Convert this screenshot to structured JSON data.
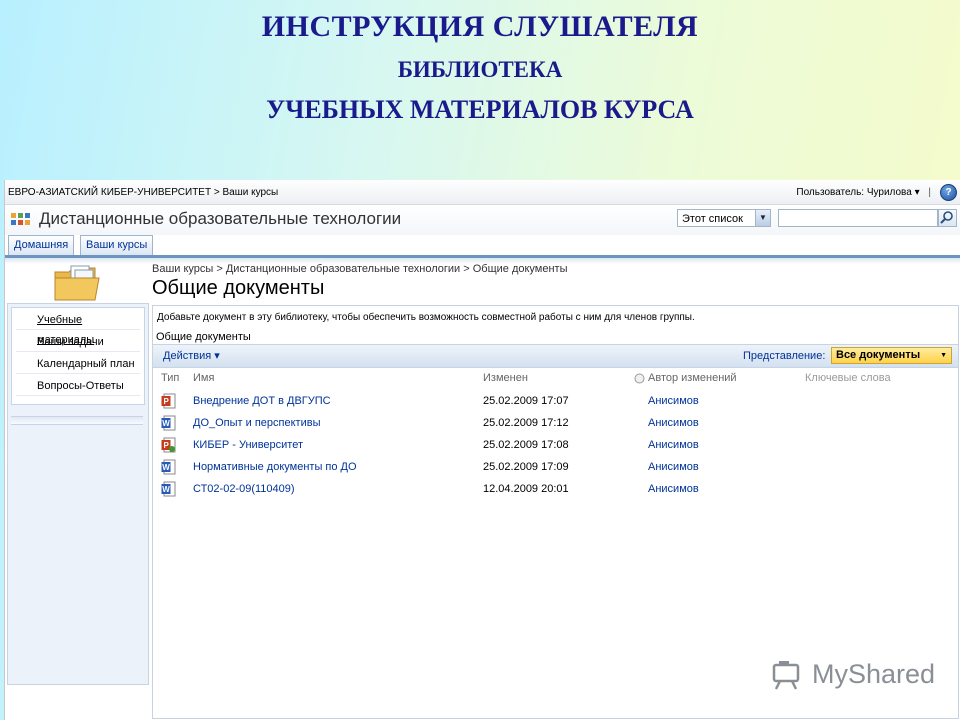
{
  "slide": {
    "title_line1": "ИНСТРУКЦИЯ СЛУШАТЕЛЯ",
    "title_line2": "БИБЛИОТЕКА",
    "title_line3": "УЧЕБНЫХ  МАТЕРИАЛОВ  КУРСА"
  },
  "topbar": {
    "breadcrumb": "ЕВРО-АЗИАТСКИЙ КИБЕР-УНИВЕРСИТЕТ > Ваши курсы",
    "user_label": "Пользователь: Чурилова ▾",
    "separator": "|",
    "help_icon": "?"
  },
  "header": {
    "site_title": "Дистанционные образовательные технологии",
    "search_scope": "Этот список",
    "search_placeholder": ""
  },
  "tabs": [
    {
      "label": "Домашняя"
    },
    {
      "label": "Ваши курсы"
    }
  ],
  "leftnav": {
    "items": [
      {
        "label": "Учебные материалы"
      },
      {
        "label": "Ваши задачи"
      },
      {
        "label": "Календарный план"
      },
      {
        "label": "Вопросы-Ответы"
      }
    ]
  },
  "main": {
    "breadcrumb": "Ваши курсы > Дистанционные образовательные технологии > Общие документы",
    "page_title": "Общие документы",
    "description": "Добавьте документ в эту библиотеку, чтобы обеспечить возможность совместной работы с ним для членов группы.",
    "library_name": "Общие документы",
    "actions_label": "Действия ▾",
    "view_label": "Представление:",
    "view_value": "Все документы"
  },
  "table": {
    "columns": [
      "Тип",
      "Имя",
      "Изменен",
      "Автор изменений",
      "Ключевые слова"
    ],
    "rows": [
      {
        "type_icon": "powerpoint-file-icon",
        "name": "Внедрение ДОТ в ДВГУПС",
        "modified": "25.02.2009 17:07",
        "author": "Анисимов"
      },
      {
        "type_icon": "word-file-icon",
        "name": "ДО_Опыт и перспективы",
        "modified": "25.02.2009 17:12",
        "author": "Анисимов"
      },
      {
        "type_icon": "powerpoint-file-icon",
        "name": "КИБЕР - Университет",
        "modified": "25.02.2009 17:08",
        "author": "Анисимов"
      },
      {
        "type_icon": "word-file-icon",
        "name": "Нормативные документы по ДО",
        "modified": "25.02.2009 17:09",
        "author": "Анисимов"
      },
      {
        "type_icon": "word-file-icon",
        "name": "СТ02-02-09(110409)",
        "modified": "12.04.2009 20:01",
        "author": "Анисимов"
      }
    ]
  },
  "watermark": {
    "text": "MyShared"
  },
  "colors": {
    "title": "#1a1a8c",
    "link": "#003399",
    "view_select": "#ffd24a"
  }
}
